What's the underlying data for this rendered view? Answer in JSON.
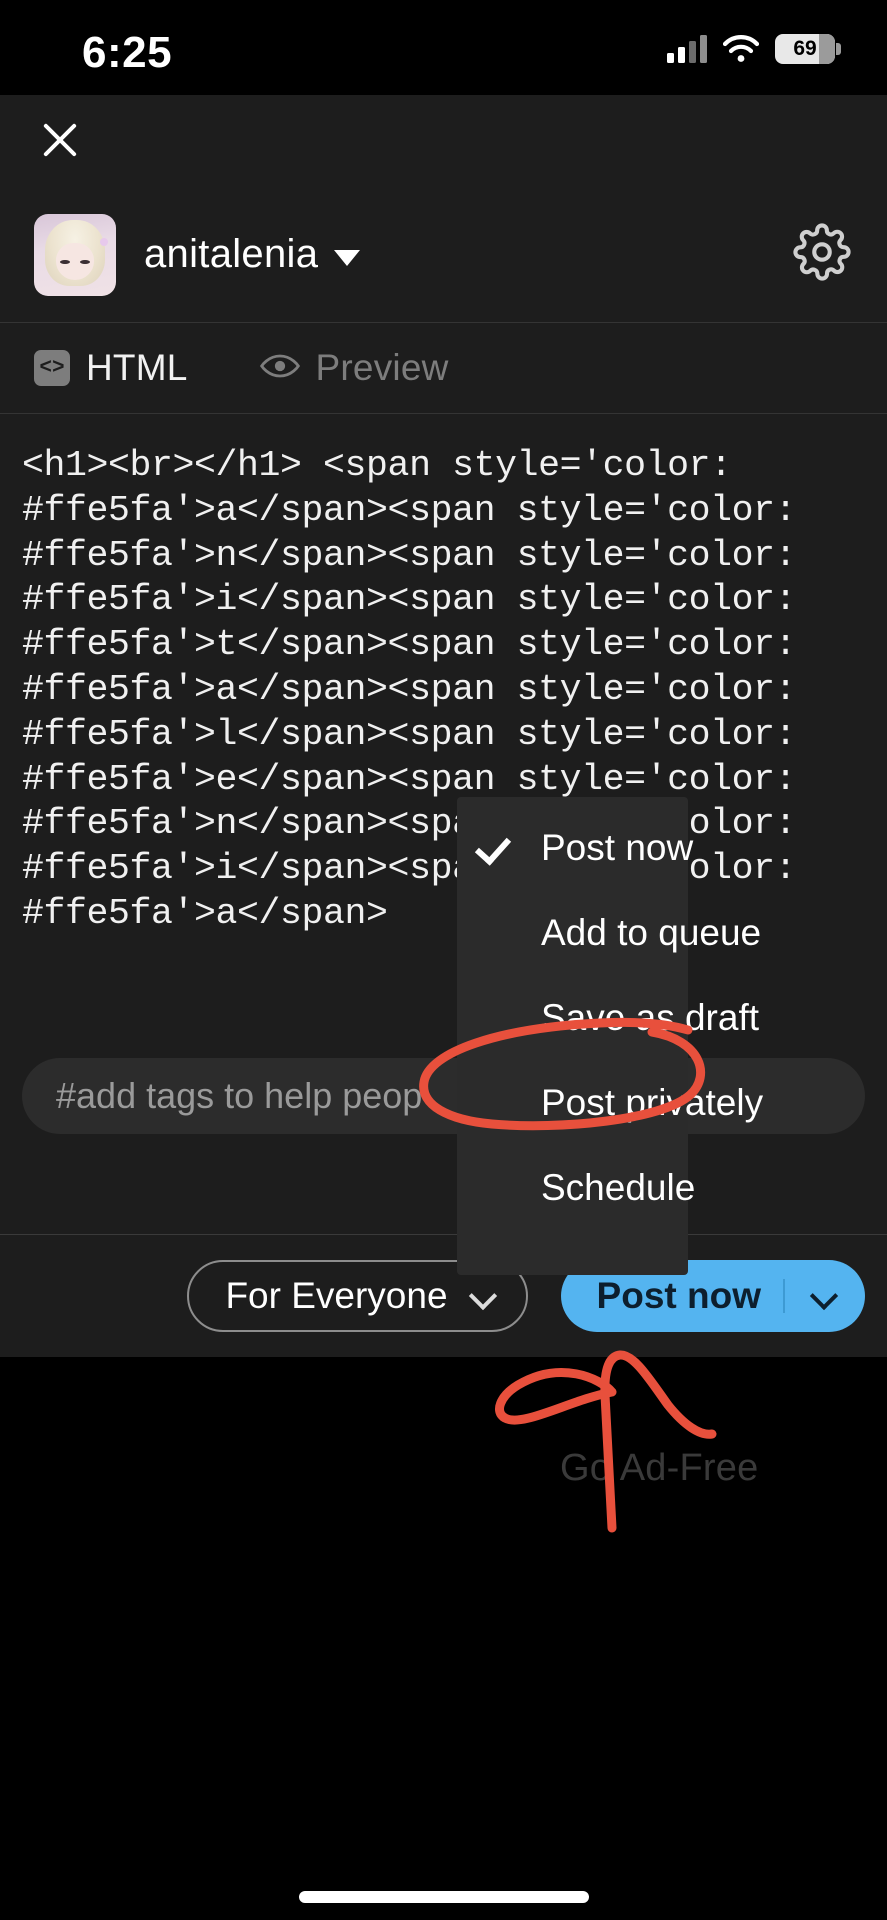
{
  "status_bar": {
    "time": "6:25",
    "battery_percent": "69",
    "icons": [
      "cellular-signal-icon",
      "wifi-icon",
      "battery-icon"
    ]
  },
  "composer": {
    "close_icon": "close-icon",
    "account": {
      "username": "anitalenia",
      "avatar_alt": "user-avatar",
      "dropdown_icon": "chevron-down-icon"
    },
    "settings_icon": "gear-icon",
    "tabs": [
      {
        "label": "HTML",
        "icon": "code-icon",
        "active": true
      },
      {
        "label": "Preview",
        "icon": "eye-icon",
        "active": false
      }
    ],
    "code_lines": [
      "<h1><br></h1> <span style='color:",
      "#ffe5fa'>a</span><span style='color:",
      "#ffe5fa'>n</span><span style='color:",
      "#ffe5fa'>i</span><span style='color:",
      "#ffe5fa'>t</span><span style='color:",
      "#ffe5fa'>a</span><span style='color:",
      "#ffe5fa'>l</span><span style='color:",
      "#ffe5fa'>e</span><span style='color:",
      "#ffe5fa'>n</span><span style='color:",
      "#ffe5fa'>i</span><span style='color:",
      "#ffe5fa'>a</span>"
    ],
    "tags_placeholder": "#add tags to help peop",
    "audience_button": {
      "label": "For Everyone",
      "icon": "chevron-down-icon"
    },
    "post_button": {
      "label": "Post now",
      "icon": "chevron-down-icon"
    }
  },
  "post_menu": {
    "items": [
      {
        "label": "Post now",
        "checked": true
      },
      {
        "label": "Add to queue",
        "checked": false
      },
      {
        "label": "Save as draft",
        "checked": false
      },
      {
        "label": "Post privately",
        "checked": false
      },
      {
        "label": "Schedule",
        "checked": false
      }
    ]
  },
  "background_page": {
    "go_ad_free": "Go Ad-Free"
  },
  "annotations": {
    "color": "#e8503c",
    "circle_target": "Save as draft",
    "arrow_target": "Post now dropdown chevron"
  },
  "colors": {
    "sheet_background": "#1d1d1d",
    "menu_background": "#2b2b2b",
    "post_button": "#54b4f0",
    "post_button_text": "#0d1f2e",
    "code_text": "#f0f0f0",
    "annotation_red": "#e8503c"
  }
}
